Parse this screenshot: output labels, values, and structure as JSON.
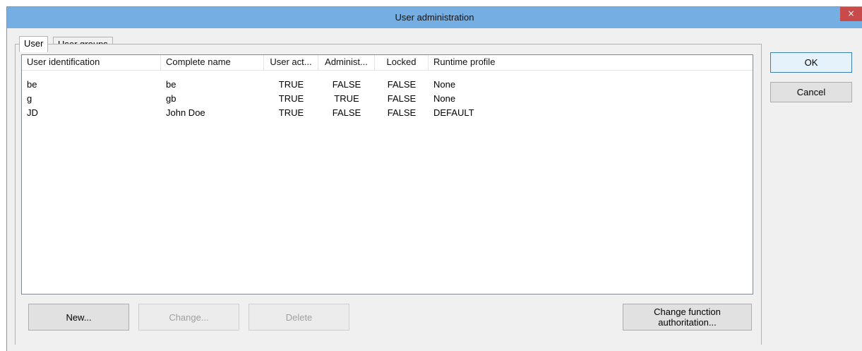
{
  "window": {
    "title": "User administration",
    "close_glyph": "×"
  },
  "tabs": [
    {
      "label": "User",
      "active": true
    },
    {
      "label": "User groups",
      "active": false
    }
  ],
  "table": {
    "columns": [
      "User identification",
      "Complete name",
      "User act...",
      "Administ...",
      "Locked",
      "Runtime profile"
    ],
    "rows": [
      [
        "be",
        "be",
        "TRUE",
        "FALSE",
        "FALSE",
        "None"
      ],
      [
        "g",
        "gb",
        "TRUE",
        "TRUE",
        "FALSE",
        "None"
      ],
      [
        "JD",
        "John Doe",
        "TRUE",
        "FALSE",
        "FALSE",
        "DEFAULT"
      ]
    ]
  },
  "buttons": {
    "new": "New...",
    "change": "Change...",
    "delete": "Delete",
    "change_function_line1": "Change function",
    "change_function_line2": "authoritation...",
    "ok": "OK",
    "cancel": "Cancel"
  },
  "colors": {
    "titlebar": "#74aee3",
    "close": "#c84a4a",
    "dialog_bg": "#f0f0f0"
  }
}
